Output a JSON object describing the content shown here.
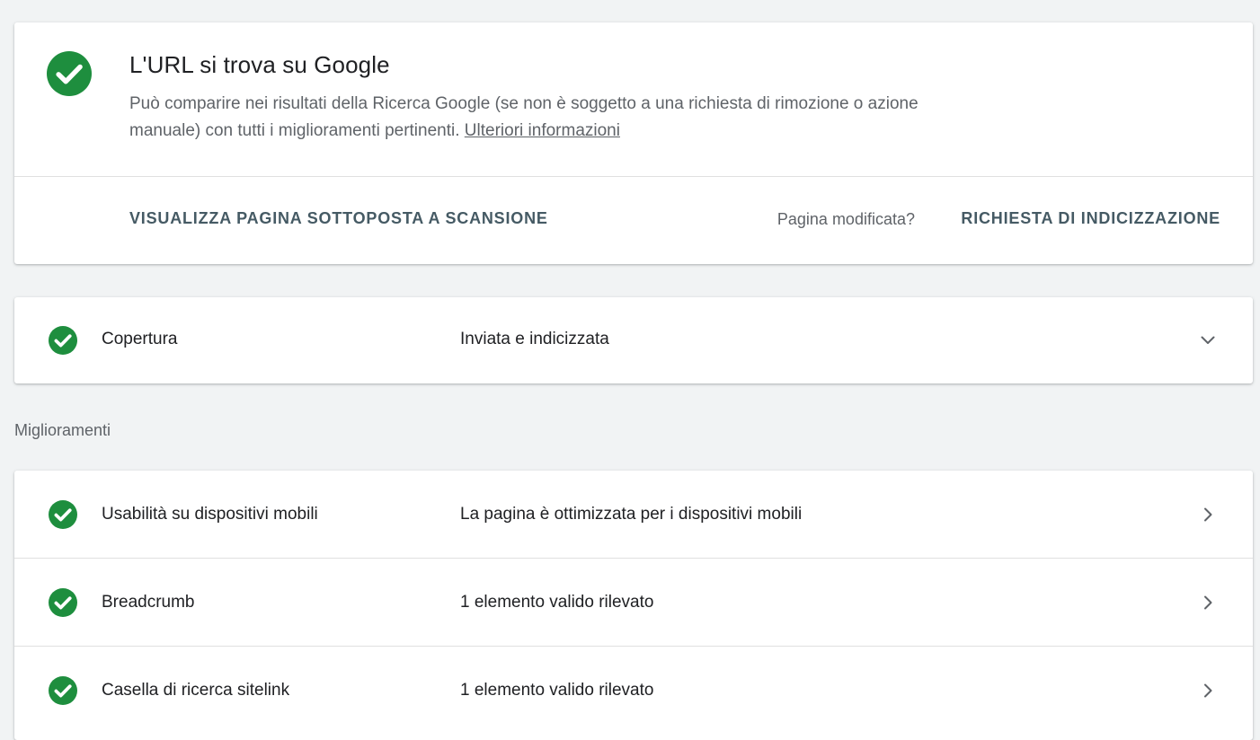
{
  "status": {
    "icon": "check-circle-icon",
    "title": "L'URL si trova su Google",
    "description": "Può comparire nei risultati della Ricerca Google (se non è soggetto a una richiesta di rimozione o azione manuale) con tutti i miglioramenti pertinenti.",
    "learn_more": "Ulteriori informazioni",
    "view_crawled": "VISUALIZZA PAGINA SOTTOPOSTA A SCANSIONE",
    "page_modified": "Pagina modificata?",
    "request_indexing": "RICHIESTA DI INDICIZZAZIONE"
  },
  "coverage": {
    "icon": "check-circle-icon",
    "label": "Copertura",
    "value": "Inviata e indicizzata",
    "chevron": "chevron-down-icon"
  },
  "enhancements": {
    "heading": "Miglioramenti",
    "items": [
      {
        "icon": "check-circle-icon",
        "label": "Usabilità su dispositivi mobili",
        "value": "La pagina è ottimizzata per i dispositivi mobili",
        "chevron": "chevron-right-icon"
      },
      {
        "icon": "check-circle-icon",
        "label": "Breadcrumb",
        "value": "1 elemento valido rilevato",
        "chevron": "chevron-right-icon"
      },
      {
        "icon": "check-circle-icon",
        "label": "Casella di ricerca sitelink",
        "value": "1 elemento valido rilevato",
        "chevron": "chevron-right-icon"
      }
    ]
  },
  "colors": {
    "success_green": "#1e8e3e",
    "action_text": "#455a64",
    "secondary_text": "#5f6368",
    "background": "#f1f3f4"
  }
}
